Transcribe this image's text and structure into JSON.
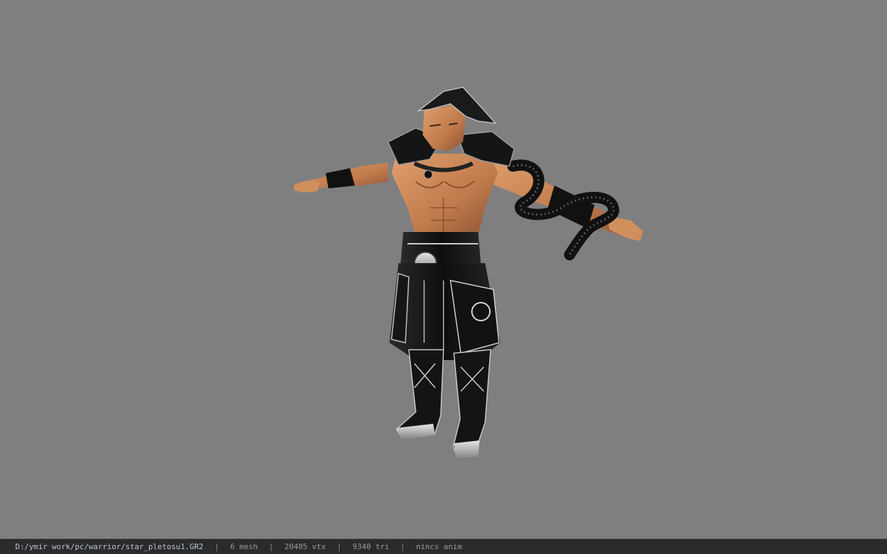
{
  "viewer": {
    "background_color": "#7f7f7f"
  },
  "model": {
    "icon": "warrior-character-model",
    "skin_color": "#c98a5a",
    "armor_color": "#1a1a1a",
    "trim_color": "#cfcfcf"
  },
  "statusbar": {
    "file_path": "D:/ymir work/pc/warrior/star_pletosu1.GR2",
    "mesh_count": "6 mesh",
    "vertex_count": "20405 vtx",
    "triangle_count": "9340 tri",
    "animation": "nincs anim",
    "separator": "|"
  }
}
